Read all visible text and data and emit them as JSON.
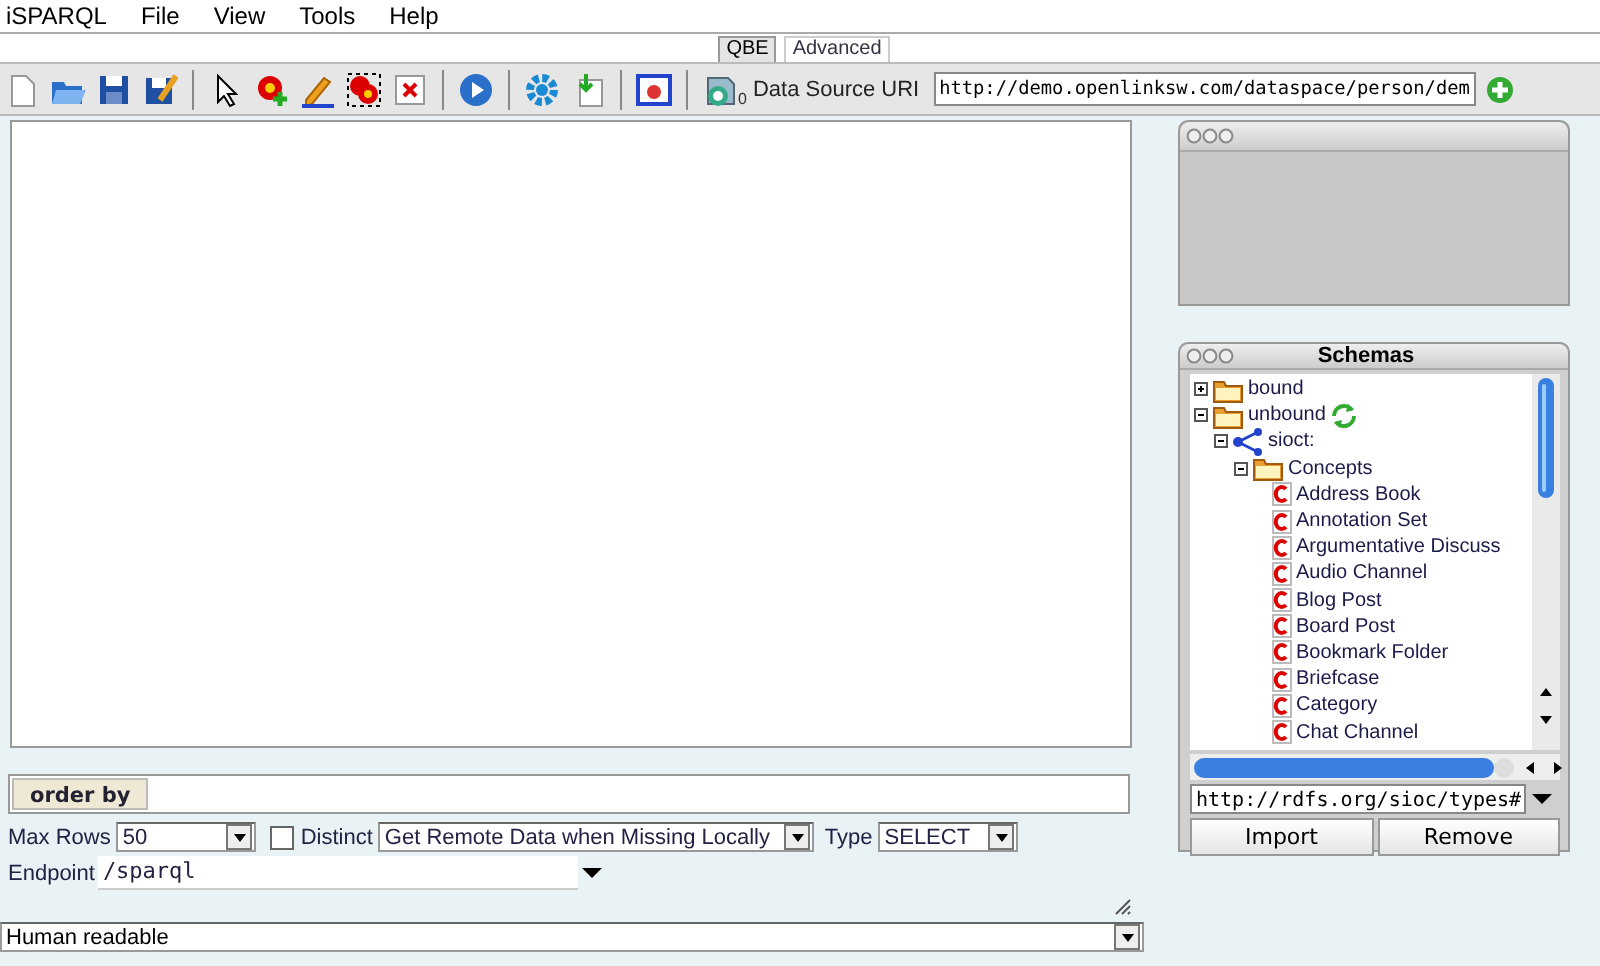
{
  "menu_bar": {
    "app_name": "iSPARQL",
    "items": [
      "File",
      "View",
      "Tools",
      "Help"
    ]
  },
  "tabs": [
    {
      "label": "QBE",
      "selected": true
    },
    {
      "label": "Advanced",
      "selected": false
    }
  ],
  "toolbar": {
    "dataset_count": "0",
    "data_source_label": "Data Source URI",
    "data_source_value": "http://demo.openlinksw.com/dataspace/person/dem"
  },
  "schemas_panel": {
    "title": "Schemas",
    "tree": [
      {
        "label": "bound",
        "kind": "folder",
        "expanded": false
      },
      {
        "label": "unbound",
        "kind": "folder",
        "expanded": true,
        "refresh": true,
        "children": [
          {
            "label": "sioct:",
            "kind": "namespace",
            "expanded": true,
            "children": [
              {
                "label": "Concepts",
                "kind": "folder",
                "expanded": true,
                "children": [
                  {
                    "label": "Address Book",
                    "kind": "class"
                  },
                  {
                    "label": "Annotation Set",
                    "kind": "class"
                  },
                  {
                    "label": "Argumentative Discuss",
                    "kind": "class"
                  },
                  {
                    "label": "Audio Channel",
                    "kind": "class"
                  },
                  {
                    "label": "Blog Post",
                    "kind": "class"
                  },
                  {
                    "label": "Board Post",
                    "kind": "class"
                  },
                  {
                    "label": "Bookmark Folder",
                    "kind": "class"
                  },
                  {
                    "label": "Briefcase",
                    "kind": "class"
                  },
                  {
                    "label": "Category",
                    "kind": "class"
                  },
                  {
                    "label": "Chat Channel",
                    "kind": "class"
                  }
                ]
              }
            ]
          }
        ]
      }
    ],
    "schema_uri": "http://rdfs.org/sioc/types#",
    "buttons": [
      "Import",
      "Remove"
    ]
  },
  "order_by": {
    "label": "order by"
  },
  "options": {
    "max_rows_label": "Max Rows",
    "max_rows": "50",
    "distinct_label": "Distinct",
    "distinct": false,
    "fetch_mode": "Get Remote Data when Missing Locally",
    "type_label": "Type",
    "type": "SELECT",
    "endpoint_label": "Endpoint",
    "endpoint": "/sparql"
  },
  "output_format": "Human readable"
}
